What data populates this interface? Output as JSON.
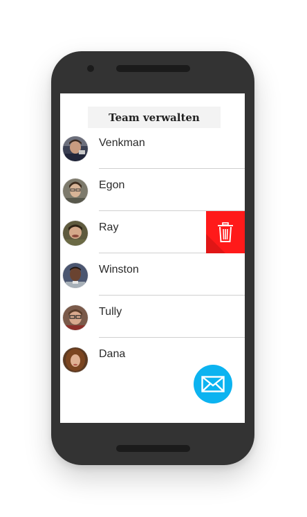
{
  "header": {
    "title": "Team verwalten"
  },
  "team": [
    {
      "name": "Venkman",
      "avatar": "avatar-venkman"
    },
    {
      "name": "Egon",
      "avatar": "avatar-egon"
    },
    {
      "name": "Ray",
      "avatar": "avatar-ray",
      "swipe_action": "trash-icon"
    },
    {
      "name": "Winston",
      "avatar": "avatar-winston"
    },
    {
      "name": "Tully",
      "avatar": "avatar-tully"
    },
    {
      "name": "Dana",
      "avatar": "avatar-dana"
    }
  ],
  "actions": {
    "delete_icon": "trash-icon",
    "delete_color": "#ff1a1a",
    "fab_icon": "envelope-icon",
    "fab_color": "#0cb3f0"
  },
  "device": {
    "frame_color": "#333333"
  }
}
